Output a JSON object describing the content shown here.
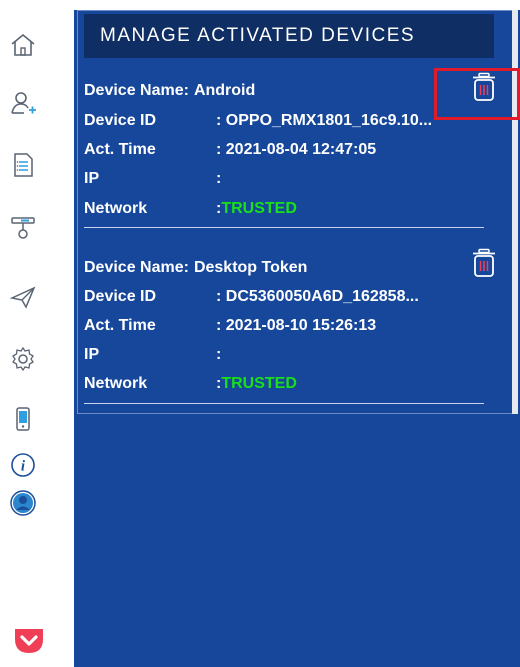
{
  "header": {
    "title": "MANAGE ACTIVATED DEVICES"
  },
  "sidebar": {
    "items": [
      {
        "name": "home-icon"
      },
      {
        "name": "add-user-icon"
      },
      {
        "name": "document-list-icon"
      },
      {
        "name": "token-key-icon"
      },
      {
        "name": "send-icon"
      },
      {
        "name": "settings-gear-icon"
      },
      {
        "name": "mobile-device-icon"
      },
      {
        "name": "info-icon"
      },
      {
        "name": "profile-icon"
      }
    ],
    "bottom": {
      "name": "pocket-icon"
    }
  },
  "devices": [
    {
      "name_label": "Device  Name:",
      "name_value": "Android",
      "id_label": "Device ID",
      "id_value": ": OPPO_RMX1801_16c9.10...",
      "time_label": "Act. Time",
      "time_value": ": 2021-08-04 12:47:05",
      "ip_label": "IP",
      "ip_value": ":",
      "network_label": "Network",
      "network_colon": ":",
      "network_value": "TRUSTED"
    },
    {
      "name_label": "Device  Name:",
      "name_value": "Desktop Token",
      "id_label": "Device ID",
      "id_value": ": DC5360050A6D_162858...",
      "time_label": "Act. Time",
      "time_value": ": 2021-08-10 15:26:13",
      "ip_label": "IP",
      "ip_value": ":",
      "network_label": "Network",
      "network_colon": ":",
      "network_value": "TRUSTED"
    }
  ],
  "colors": {
    "panel_bg": "#16479a",
    "header_bg": "#0f2e63",
    "trusted": "#19e019",
    "highlight": "#e21b2a",
    "pocket": "#ef3e56"
  }
}
